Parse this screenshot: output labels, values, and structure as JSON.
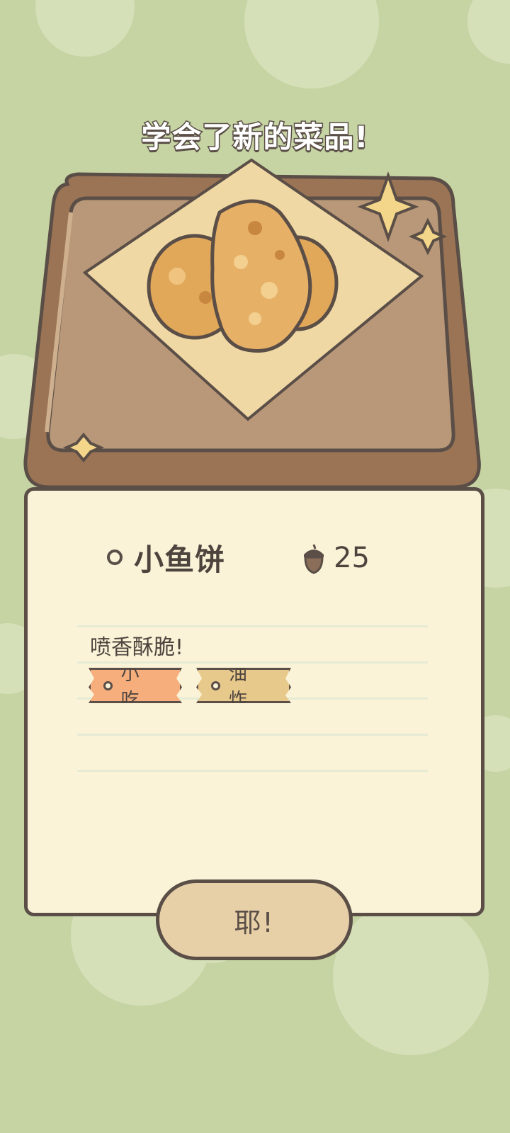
{
  "header": {
    "title": "学会了新的菜品!"
  },
  "dish": {
    "name": "小鱼饼",
    "price": "25",
    "price_icon": "acorn-icon",
    "description": "喷香酥脆!",
    "tags": [
      "小吃",
      "油炸"
    ]
  },
  "actions": {
    "confirm_label": "耶!"
  },
  "colors": {
    "background": "#c6d4a4",
    "card": "#fbf3d8",
    "outline": "#5a4e47",
    "tray": "#9a7455",
    "tag_snack": "#f6ae7d",
    "tag_fried": "#e8c98c",
    "button": "#e7d0a8"
  }
}
